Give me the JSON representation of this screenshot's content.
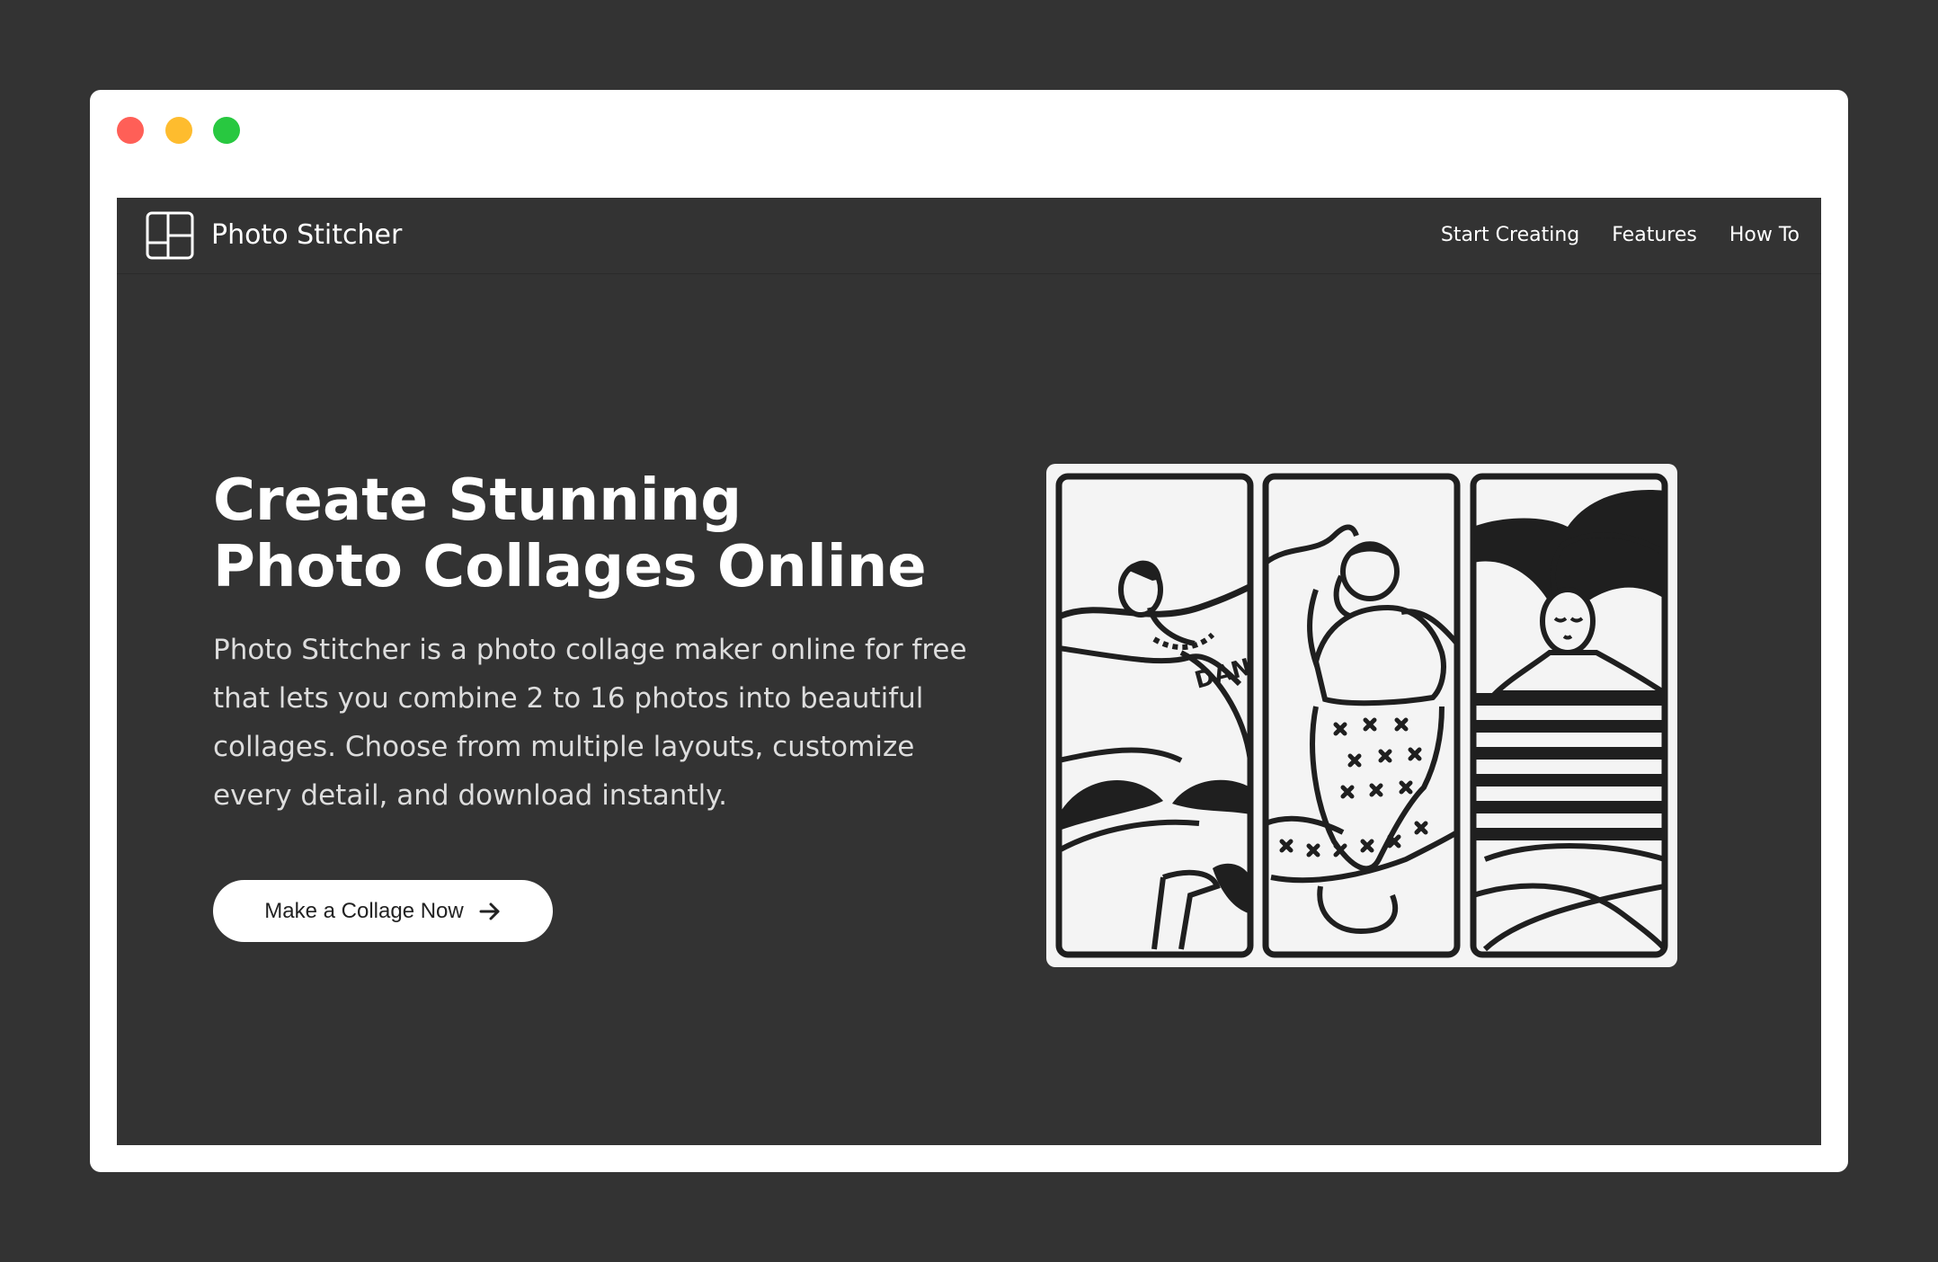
{
  "window": {
    "traffic_lights": [
      "red",
      "yellow",
      "green"
    ]
  },
  "navbar": {
    "logo_icon": "grid-layout-icon",
    "brand": "Photo Stitcher",
    "links": [
      {
        "label": "Start Creating"
      },
      {
        "label": "Features"
      },
      {
        "label": "How To"
      }
    ]
  },
  "hero": {
    "title": "Create Stunning Photo Collages Online",
    "description": "Photo Stitcher is a photo collage maker online for free that lets you combine 2 to 16 photos into beautiful collages. Choose from multiple layouts, customize every detail, and download instantly.",
    "cta_label": "Make a Collage Now",
    "cta_icon": "arrow-right-icon"
  },
  "collage_preview": {
    "panels": 3,
    "panel_illustrations": [
      "running-man-illustration",
      "dancing-person-illustration",
      "woman-striped-shirt-illustration"
    ],
    "illustration_text": "DAN"
  },
  "colors": {
    "page_background": "#333333",
    "window_frame": "#ffffff",
    "traffic_red": "#ff5f57",
    "traffic_yellow": "#febc2e",
    "traffic_green": "#28c840",
    "button_bg": "#ffffff",
    "text_primary": "#ffffff"
  }
}
